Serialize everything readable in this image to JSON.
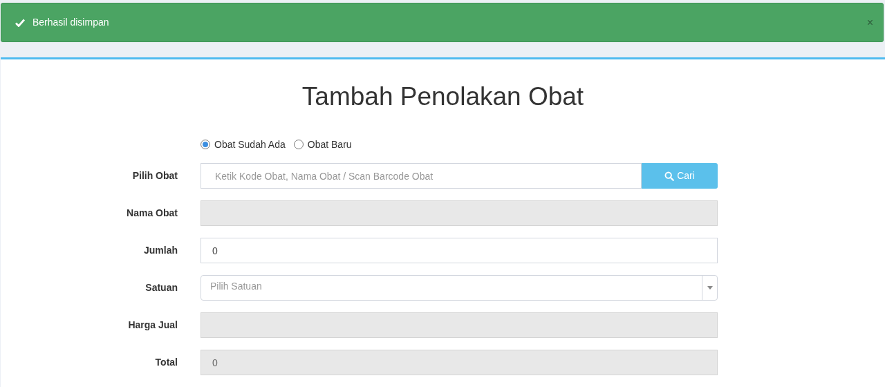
{
  "alert": {
    "message": "Berhasil disimpan",
    "close": "×"
  },
  "form": {
    "title": "Tambah Penolakan Obat",
    "radios": [
      {
        "label": "Obat Sudah Ada",
        "selected": true
      },
      {
        "label": "Obat Baru",
        "selected": false
      }
    ],
    "fields": [
      {
        "kind": "search",
        "label": "Pilih Obat",
        "placeholder": "Ketik Kode Obat, Nama Obat / Scan Barcode Obat",
        "button": "Cari"
      },
      {
        "kind": "text",
        "label": "Nama Obat",
        "disabled": true
      },
      {
        "kind": "text",
        "label": "Jumlah",
        "value": "0",
        "disabled": false
      },
      {
        "kind": "select",
        "label": "Satuan",
        "placeholder": "Pilih Satuan"
      },
      {
        "kind": "text",
        "label": "Harga Jual",
        "disabled": true
      },
      {
        "kind": "text",
        "label": "Total",
        "value": "0",
        "disabled": true
      }
    ]
  }
}
